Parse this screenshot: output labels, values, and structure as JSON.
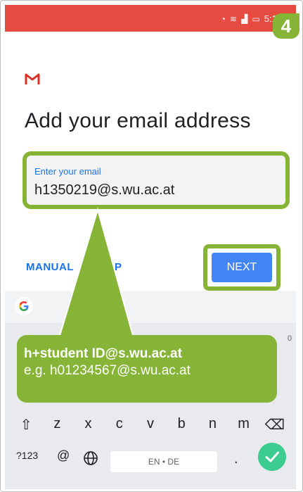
{
  "status": {
    "time": "5:13",
    "icons": [
      "data-saver-icon",
      "wifi-icon",
      "signal-icon",
      "battery-icon"
    ]
  },
  "step": {
    "number": "4"
  },
  "header": {
    "title": "Add your email address",
    "logo": "gmail-logo"
  },
  "email": {
    "label": "Enter your email",
    "value": "h1350219@s.wu.ac.at"
  },
  "actions": {
    "manual_label": "MANUAL",
    "manual_tail": "P",
    "next_label": "NEXT"
  },
  "keyboard": {
    "row3": [
      "z",
      "x",
      "c",
      "v",
      "b",
      "n",
      "m"
    ],
    "sym_label": "?123",
    "at_label": "@",
    "space_label": "EN • DE",
    "dot_label": ".",
    "stray": "0"
  },
  "callout": {
    "line1": "h+student ID@s.wu.ac.at",
    "line2": "e.g. h01234567@s.wu.ac.at"
  },
  "colors": {
    "accent": "#86b436",
    "status_bar": "#e64b41",
    "button": "#4285f4",
    "link": "#1a73e8"
  }
}
